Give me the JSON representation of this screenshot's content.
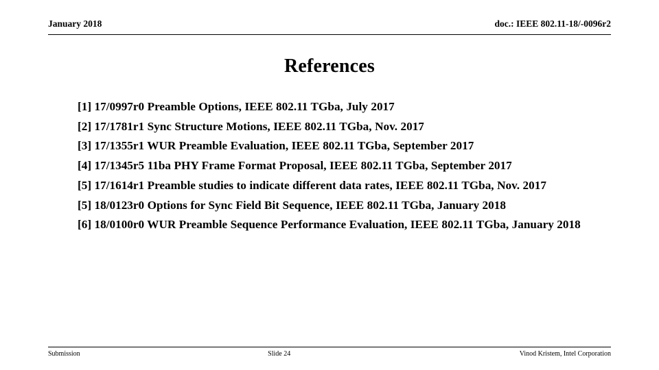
{
  "header": {
    "left": "January 2018",
    "right": "doc.: IEEE 802.11-18/-0096r2"
  },
  "title": "References",
  "references": [
    "[1] 17/0997r0 Preamble  Options, IEEE 802.11 TGba, July 2017",
    "[2] 17/1781r1 Sync Structure Motions, IEEE 802.11 TGba, Nov. 2017",
    "[3] 17/1355r1 WUR Preamble Evaluation, IEEE 802.11 TGba, September 2017",
    "[4] 17/1345r5 11ba PHY Frame Format Proposal, IEEE 802.11 TGba, September 2017",
    "[5] 17/1614r1 Preamble studies to indicate different data rates, IEEE 802.11 TGba, Nov. 2017",
    "[5] 18/0123r0 Options for Sync Field Bit Sequence, IEEE 802.11 TGba, January 2018",
    "[6] 18/0100r0 WUR Preamble Sequence Performance Evaluation, IEEE 802.11 TGba, January 2018"
  ],
  "footer": {
    "left": "Submission",
    "center": "Slide 24",
    "right": "Vinod Kristem, Intel Corporation"
  },
  "colors": {
    "text": "#000000",
    "background": "#ffffff",
    "rule": "#000000"
  }
}
